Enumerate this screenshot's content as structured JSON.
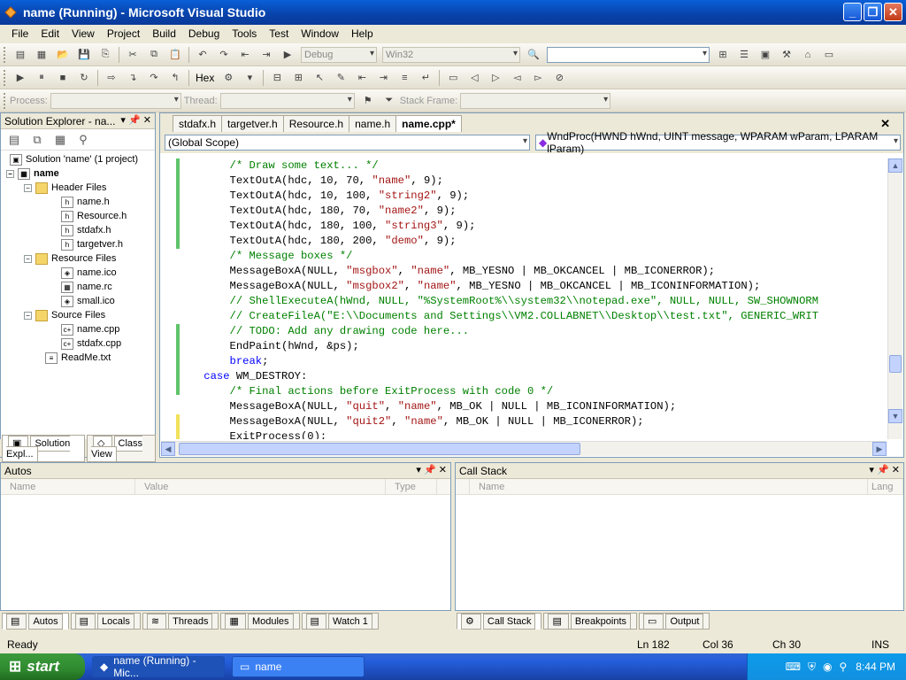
{
  "window": {
    "title": "name (Running) - Microsoft Visual Studio"
  },
  "menu": [
    "File",
    "Edit",
    "View",
    "Project",
    "Build",
    "Debug",
    "Tools",
    "Test",
    "Window",
    "Help"
  ],
  "toolbar": {
    "config": "Debug",
    "platform": "Win32",
    "hex_label": "Hex",
    "process_label": "Process:",
    "thread_label": "Thread:",
    "stackframe_label": "Stack Frame:"
  },
  "solution_explorer": {
    "title": "Solution Explorer - na...",
    "solution": "Solution 'name' (1 project)",
    "project": "name",
    "header_folder": "Header Files",
    "header_files": [
      "name.h",
      "Resource.h",
      "stdafx.h",
      "targetver.h"
    ],
    "resource_folder": "Resource Files",
    "resource_files": [
      "name.ico",
      "name.rc",
      "small.ico"
    ],
    "source_folder": "Source Files",
    "source_files": [
      "name.cpp",
      "stdafx.cpp"
    ],
    "readme": "ReadMe.txt",
    "tab_solution": "Solution Expl...",
    "tab_class": "Class View"
  },
  "editor": {
    "tabs": [
      "stdafx.h",
      "targetver.h",
      "Resource.h",
      "name.h",
      "name.cpp*"
    ],
    "active_tab": "name.cpp*",
    "scope": "(Global Scope)",
    "function": "WndProc(HWND hWnd, UINT message, WPARAM wParam, LPARAM lParam)",
    "lines": [
      "        /* Draw some text... */",
      "        TextOutA(hdc, 10, 70, \"name\", 9);",
      "        TextOutA(hdc, 10, 100, \"string2\", 9);",
      "        TextOutA(hdc, 180, 70, \"name2\", 9);",
      "        TextOutA(hdc, 180, 100, \"string3\", 9);",
      "        TextOutA(hdc, 180, 200, \"demo\", 9);",
      "        /* Message boxes */",
      "        MessageBoxA(NULL, \"msgbox\", \"name\", MB_YESNO | MB_OKCANCEL | MB_ICONERROR);",
      "        MessageBoxA(NULL, \"msgbox2\", \"name\", MB_YESNO | MB_OKCANCEL | MB_ICONINFORMATION);",
      "        // ShellExecuteA(hWnd, NULL, \"%SystemRoot%\\\\system32\\\\notepad.exe\", NULL, NULL, SW_SHOWNORM",
      "        // CreateFileA(\"E:\\\\Documents and Settings\\\\VM2.COLLABNET\\\\Desktop\\\\test.txt\", GENERIC_WRIT",
      "        // TODO: Add any drawing code here...",
      "        EndPaint(hWnd, &ps);",
      "        break;",
      "    case WM_DESTROY:",
      "        /* Final actions before ExitProcess with code 0 */",
      "        MessageBoxA(NULL, \"quit\", \"name\", MB_OK | NULL | MB_ICONINFORMATION);",
      "        MessageBoxA(NULL, \"quit2\", \"name\", MB_OK | NULL | MB_ICONERROR);",
      "        ExitProcess(0);"
    ]
  },
  "autos": {
    "title": "Autos",
    "columns": [
      "Name",
      "Value",
      "Type"
    ],
    "tabs": [
      "Autos",
      "Locals",
      "Threads",
      "Modules",
      "Watch 1"
    ]
  },
  "callstack": {
    "title": "Call Stack",
    "columns": [
      "Name",
      "Lang"
    ],
    "tabs": [
      "Call Stack",
      "Breakpoints",
      "Output"
    ]
  },
  "status": {
    "ready": "Ready",
    "ln": "Ln 182",
    "col": "Col 36",
    "ch": "Ch 30",
    "mode": "INS"
  },
  "taskbar": {
    "start": "start",
    "task1": "name (Running) - Mic...",
    "task2": "name",
    "clock": "8:44 PM"
  }
}
